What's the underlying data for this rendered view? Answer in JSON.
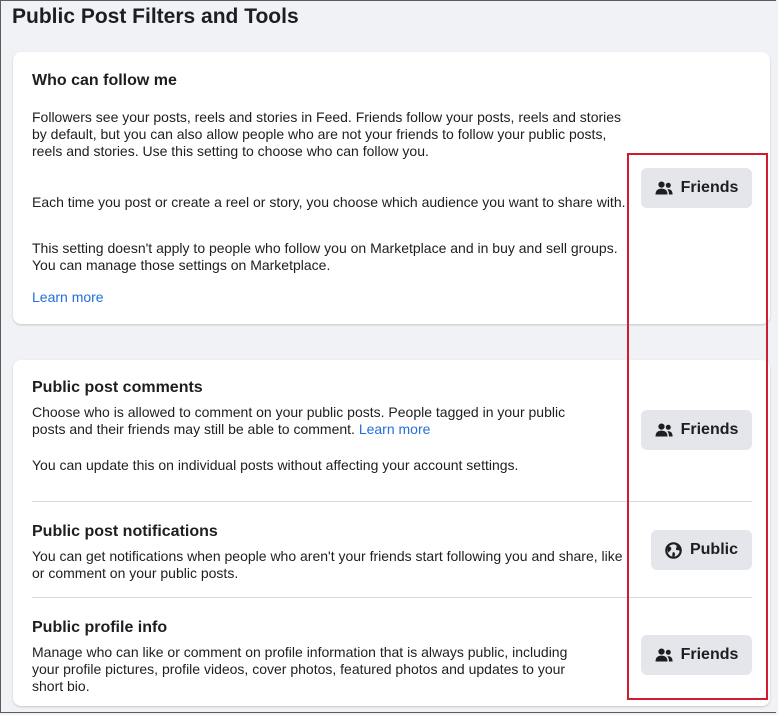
{
  "page": {
    "title": "Public Post Filters and Tools"
  },
  "follow": {
    "title": "Who can follow me",
    "p1": "Followers see your posts, reels and stories in Feed. Friends follow your posts, reels and stories by default, but you can also allow people who are not your friends to follow your public posts, reels and stories. Use this setting to choose who can follow you.",
    "p2": "Each time you post or create a reel or story, you choose which audience you want to share with.",
    "p3": "This setting doesn't apply to people who follow you on Marketplace and in buy and sell groups. You can manage those settings on Marketplace.",
    "learn_more": "Learn more",
    "button_label": "Friends",
    "button_icon": "friends-icon"
  },
  "comments": {
    "title": "Public post comments",
    "p1": "Choose who is allowed to comment on your public posts. People tagged in your public posts and their friends may still be able to comment.",
    "learn_more": "Learn more",
    "p2": "You can update this on individual posts without affecting your account settings.",
    "button_label": "Friends",
    "button_icon": "friends-icon"
  },
  "notifications": {
    "title": "Public post notifications",
    "p1": "You can get notifications when people who aren't your friends start following you and share, like or comment on your public posts.",
    "button_label": "Public",
    "button_icon": "globe-icon"
  },
  "profile_info": {
    "title": "Public profile info",
    "p1": "Manage who can like or comment on profile information that is always public, including your profile pictures, profile videos, cover photos, featured photos and updates to your short bio.",
    "button_label": "Friends",
    "button_icon": "friends-icon"
  },
  "colors": {
    "background": "#f0f2f5",
    "card": "#ffffff",
    "button": "#e4e6eb",
    "link": "#216fdb",
    "highlight": "#d01c2c"
  }
}
